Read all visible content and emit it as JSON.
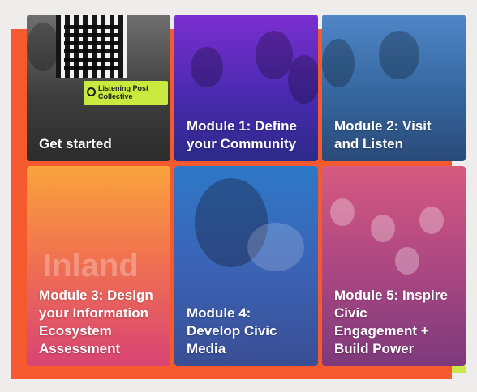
{
  "cards": [
    {
      "label": "Get started"
    },
    {
      "label": "Module 1: Define\nyour Community"
    },
    {
      "label": "Module 2: Visit\nand Listen"
    },
    {
      "label": "Module 3: Design\nyour Information\nEcosystem\nAssessment"
    },
    {
      "label": "Module 4:\nDevelop Civic\nMedia"
    },
    {
      "label": "Module 5: Inspire\nCivic\nEngagement +\nBuild Power"
    }
  ],
  "photo_text": {
    "poster": "Listening Post\nCollective",
    "sign": "Inland"
  }
}
